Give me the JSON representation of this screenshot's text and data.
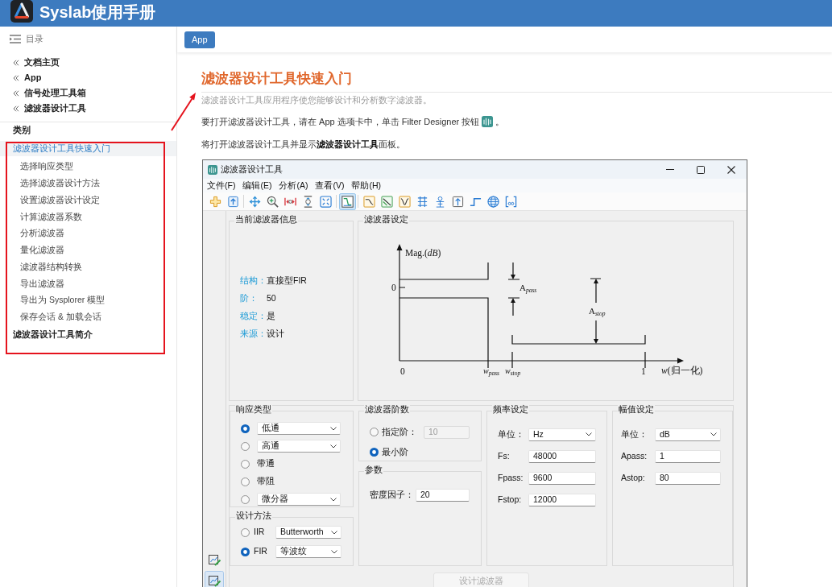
{
  "header": {
    "title": "Syslab使用手册"
  },
  "sidebar": {
    "toc_label": "目录",
    "breadcrumbs": [
      "文档主页",
      "App",
      "信号处理工具箱",
      "滤波器设计工具"
    ],
    "category_heading": "类别",
    "items": [
      {
        "label": "滤波器设计工具快速入门",
        "selected": true,
        "children": [
          {
            "label": "选择响应类型",
            "selected": false
          },
          {
            "label": "选择滤波器设计方法",
            "selected": false
          },
          {
            "label": "设置滤波器设计设定",
            "selected": false
          },
          {
            "label": "计算滤波器系数",
            "selected": false
          },
          {
            "label": "分析滤波器",
            "selected": false
          },
          {
            "label": "量化滤波器",
            "selected": false
          },
          {
            "label": "滤波器结构转换",
            "selected": false
          },
          {
            "label": "导出滤波器",
            "selected": false
          },
          {
            "label": "导出为 Sysplorer 模型",
            "selected": false
          },
          {
            "label": "保存会话 & 加载会话",
            "selected": false
          }
        ]
      },
      {
        "label": "滤波器设计工具简介",
        "selected": false
      }
    ]
  },
  "top_bar": {
    "button": "App"
  },
  "article": {
    "title": "滤波器设计工具快速入门",
    "summary": "滤波器设计工具应用程序使您能够设计和分析数字滤波器。",
    "steps": [
      {
        "kind": "with_icon",
        "text": "要打开滤波器设计工具，请在 App 选项卡中，单击 Filter Designer 按钮",
        "suffix": "。"
      },
      {
        "kind": "plain",
        "text": "将打开滤波器设计工具并显示**滤波器设计工具**面板。"
      }
    ]
  },
  "app_window": {
    "title": "滤波器设计工具",
    "menu": [
      "文件(F)",
      "编辑(E)",
      "分析(A)",
      "查看(V)",
      "帮助(H)"
    ],
    "toolbar": [
      {
        "selected": false
      },
      {
        "selected": false
      },
      {
        "selected": false
      },
      {
        "selected": false
      },
      {
        "selected": false
      },
      {
        "selected": false
      },
      {
        "selected": false
      },
      {
        "selected": true
      },
      {
        "selected": false
      },
      {
        "selected": false
      },
      {
        "selected": false
      },
      {
        "selected": false
      },
      {
        "selected": false
      },
      {
        "selected": false
      },
      {
        "selected": false
      },
      {
        "selected": false
      },
      {
        "selected": false
      }
    ],
    "side_tools": [
      {
        "selected": false
      },
      {
        "selected": true
      }
    ],
    "info_panel": {
      "title": "当前滤波器信息",
      "rows": [
        {
          "label": "结构：",
          "value": "直接型FIR"
        },
        {
          "label": "阶：",
          "value": "50"
        },
        {
          "label": "稳定：",
          "value": "是"
        },
        {
          "label": "来源：",
          "value": "设计"
        }
      ]
    },
    "spec_panel": {
      "title": "滤波器设定",
      "diagram": {
        "y_axis": "Mag.(*dB*)",
        "y_zero": "0",
        "a_pass": "A$_{pass}$",
        "a_stop": "A$_{stop}$",
        "x_zero": "0",
        "w_pass": "w$_{pass}$",
        "w_stop": "w$_{stop}$",
        "x_one": "1",
        "x_axis": "*w*(归一化)"
      }
    },
    "response_type": {
      "title": "响应类型",
      "options": [
        {
          "kind": "dropdown",
          "value": "低通",
          "selected": true
        },
        {
          "kind": "dropdown",
          "value": "高通",
          "selected": false
        },
        {
          "kind": "label",
          "label": "带通",
          "selected": false
        },
        {
          "kind": "label",
          "label": "带阻",
          "selected": false
        },
        {
          "kind": "dropdown",
          "value": "微分器",
          "selected": false
        }
      ]
    },
    "design_method": {
      "title": "设计方法",
      "options": [
        {
          "label": "IIR",
          "value": "Butterworth",
          "selected": false
        },
        {
          "label": "FIR",
          "value": "等波纹",
          "selected": true
        }
      ]
    },
    "filter_order": {
      "title": "滤波器阶数",
      "options": [
        {
          "kind": "field",
          "label": "指定阶：",
          "value": "10",
          "selected": false
        },
        {
          "kind": "label",
          "label": "最小阶",
          "selected": true
        }
      ]
    },
    "parameters": {
      "title": "参数",
      "fields": [
        {
          "label": "密度因子：",
          "value": "20"
        }
      ]
    },
    "frequency": {
      "title": "频率设定",
      "unit_label": "单位：",
      "unit": "Hz",
      "fields": [
        {
          "label": "Fs:",
          "value": "48000"
        },
        {
          "label": "Fpass:",
          "value": "9600"
        },
        {
          "label": "Fstop:",
          "value": "12000"
        }
      ]
    },
    "magnitude": {
      "title": "幅值设定",
      "unit_label": "单位：",
      "unit": "dB",
      "fields": [
        {
          "label": "Apass:",
          "value": "1"
        },
        {
          "label": "Astop:",
          "value": "80"
        }
      ]
    },
    "design_button": {
      "label": "设计滤波器",
      "disabled": true
    }
  }
}
